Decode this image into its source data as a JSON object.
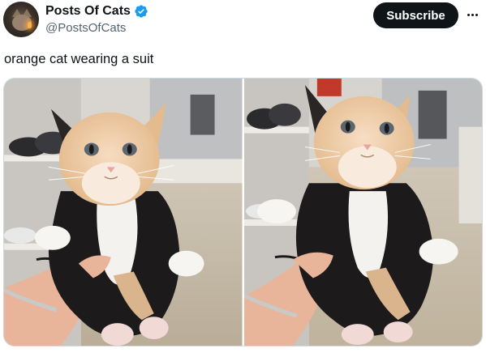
{
  "author": {
    "display_name": "Posts Of Cats",
    "handle": "@PostsOfCats",
    "verified": true,
    "avatar_icon": "cat-avatar"
  },
  "actions": {
    "subscribe_label": "Subscribe",
    "more_icon": "more-horizontal-icon"
  },
  "tweet": {
    "text": "orange cat wearing a suit"
  },
  "media": {
    "photos": [
      {
        "icon": "kitten-photo"
      },
      {
        "icon": "kitten-photo"
      }
    ]
  },
  "colors": {
    "text_primary": "#0f1419",
    "text_secondary": "#536471",
    "verified_blue": "#1d9bf0",
    "button_bg": "#0f1419",
    "button_text": "#ffffff"
  }
}
